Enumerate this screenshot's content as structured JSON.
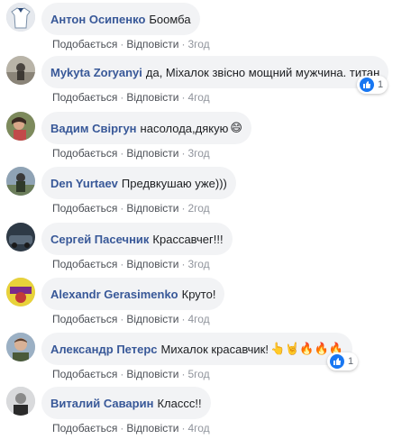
{
  "actions": {
    "like": "Подобається",
    "reply": "Відповісти",
    "sep": "·"
  },
  "comments": [
    {
      "name": "Антон Осипенко",
      "text": "Боомба",
      "emoji": "",
      "time": "3год",
      "reaction_count": null
    },
    {
      "name": "Mykyta Zoryanyi",
      "text": "да, Міхалок звісно мощний мужчина. титан",
      "emoji": "",
      "time": "4год",
      "reaction_count": "1"
    },
    {
      "name": "Вадим Свіргун",
      "text": "насолода,дякую",
      "emoji": "😄",
      "time": "3год",
      "reaction_count": null
    },
    {
      "name": "Den Yurtaev",
      "text": "Предвкушаю уже)))",
      "emoji": "",
      "time": "2год",
      "reaction_count": null
    },
    {
      "name": "Сергей Пасечник",
      "text": "Крассавчег!!!",
      "emoji": "",
      "time": "3год",
      "reaction_count": null
    },
    {
      "name": "Alexandr Gerasimenko",
      "text": "Круто!",
      "emoji": "",
      "time": "4год",
      "reaction_count": null
    },
    {
      "name": "Александр Петерс",
      "text": "Михалок красавчик!",
      "emoji": "👆🤘🔥🔥🔥",
      "time": "5год",
      "reaction_count": "1"
    },
    {
      "name": "Виталий Саварин",
      "text": "Классс!!",
      "emoji": "",
      "time": "4год",
      "reaction_count": null
    }
  ],
  "colors": {
    "name_link": "#385898",
    "bubble_bg": "#f2f3f5",
    "meta_text": "#90949c",
    "like_blue": "#1877f2"
  }
}
